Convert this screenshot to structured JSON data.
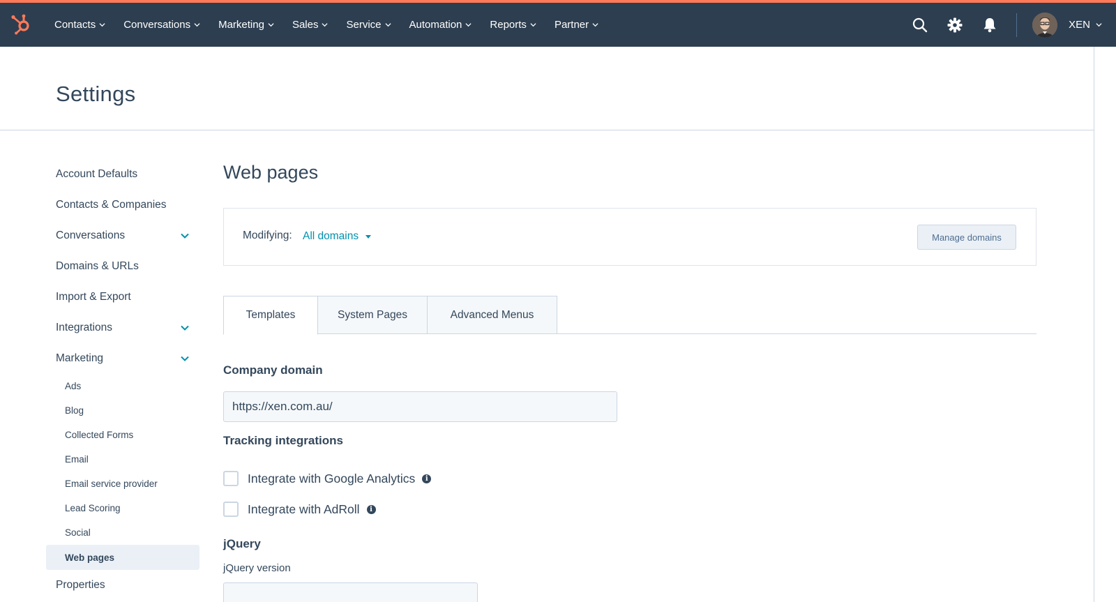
{
  "nav": {
    "items": [
      "Contacts",
      "Conversations",
      "Marketing",
      "Sales",
      "Service",
      "Automation",
      "Reports",
      "Partner"
    ],
    "account": "XEN"
  },
  "header": {
    "title": "Settings"
  },
  "sidebar": {
    "items": [
      {
        "label": "Account Defaults"
      },
      {
        "label": "Contacts & Companies"
      },
      {
        "label": "Conversations",
        "expandable": true
      },
      {
        "label": "Domains & URLs"
      },
      {
        "label": "Import & Export"
      },
      {
        "label": "Integrations",
        "expandable": true
      },
      {
        "label": "Marketing",
        "expandable": true
      }
    ],
    "marketing_sub": [
      "Ads",
      "Blog",
      "Collected Forms",
      "Email",
      "Email service provider",
      "Lead Scoring",
      "Social",
      "Web pages"
    ],
    "active_sub": "Web pages",
    "after": "Properties"
  },
  "main": {
    "title": "Web pages",
    "modifying_label": "Modifying:",
    "modifying_value": "All domains",
    "manage_button": "Manage domains",
    "tabs": [
      "Templates",
      "System Pages",
      "Advanced Menus"
    ],
    "active_tab": "Templates",
    "company_domain": {
      "heading": "Company domain",
      "value": "https://xen.com.au/"
    },
    "tracking": {
      "heading": "Tracking integrations",
      "options": [
        {
          "label": "Integrate with Google Analytics",
          "checked": false
        },
        {
          "label": "Integrate with AdRoll",
          "checked": false
        }
      ]
    },
    "jquery": {
      "heading": "jQuery",
      "version_label": "jQuery version"
    }
  },
  "colors": {
    "nav_bg": "#2d3e50",
    "accent": "#ff7a59",
    "link": "#0091ae"
  }
}
